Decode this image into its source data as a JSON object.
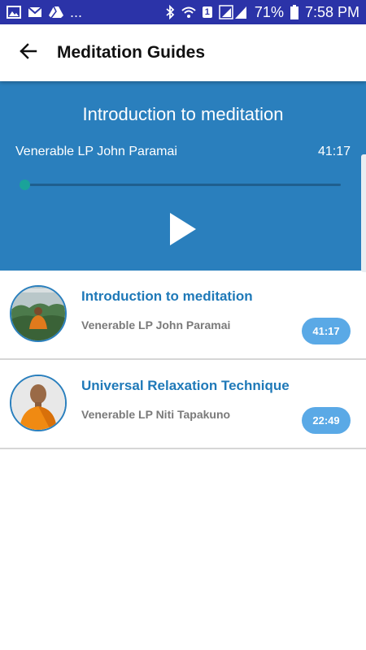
{
  "status_bar": {
    "notifications_more": "...",
    "notification_badge": "1",
    "battery": "71%",
    "time": "7:58 PM",
    "icons": [
      "image-icon",
      "mail-icon",
      "drive-icon",
      "bluetooth-icon",
      "wifi-icon",
      "signal-icon",
      "battery-icon"
    ]
  },
  "header": {
    "back_icon": "arrow-left-icon",
    "title": "Meditation Guides"
  },
  "player": {
    "title": "Introduction to meditation",
    "author": "Venerable LP John Paramai",
    "duration": "41:17",
    "progress": 0.0,
    "play_icon": "play-icon",
    "background_color": "#2a7fbd"
  },
  "guides": [
    {
      "title": "Introduction to meditation",
      "author": "Venerable LP John Paramai",
      "duration": "41:17"
    },
    {
      "title": "Universal Relaxation Technique",
      "author": "Venerable LP Niti Tapakuno",
      "duration": "22:49"
    }
  ],
  "colors": {
    "status_bar": "#2b33a8",
    "accent": "#1f79b8",
    "badge": "#5aa9e6",
    "seek_thumb": "#1aa39a"
  }
}
